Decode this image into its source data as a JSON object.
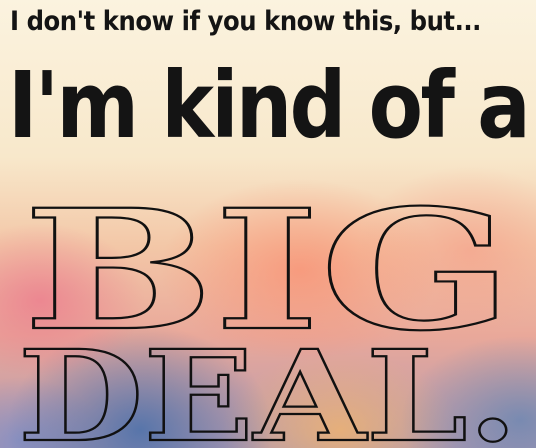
{
  "poster": {
    "line1": "I don't know if you know this, but...",
    "line2": "I'm kind of a",
    "line3": "BIG",
    "line4": "DEAL."
  },
  "colors": {
    "text": "#141414",
    "background_top": "#fbf3df",
    "background_middle": "#f3c7a7",
    "background_bottom": "#b39ab0",
    "blur_blue": "#466eaa",
    "blur_pink": "#eb788c"
  }
}
